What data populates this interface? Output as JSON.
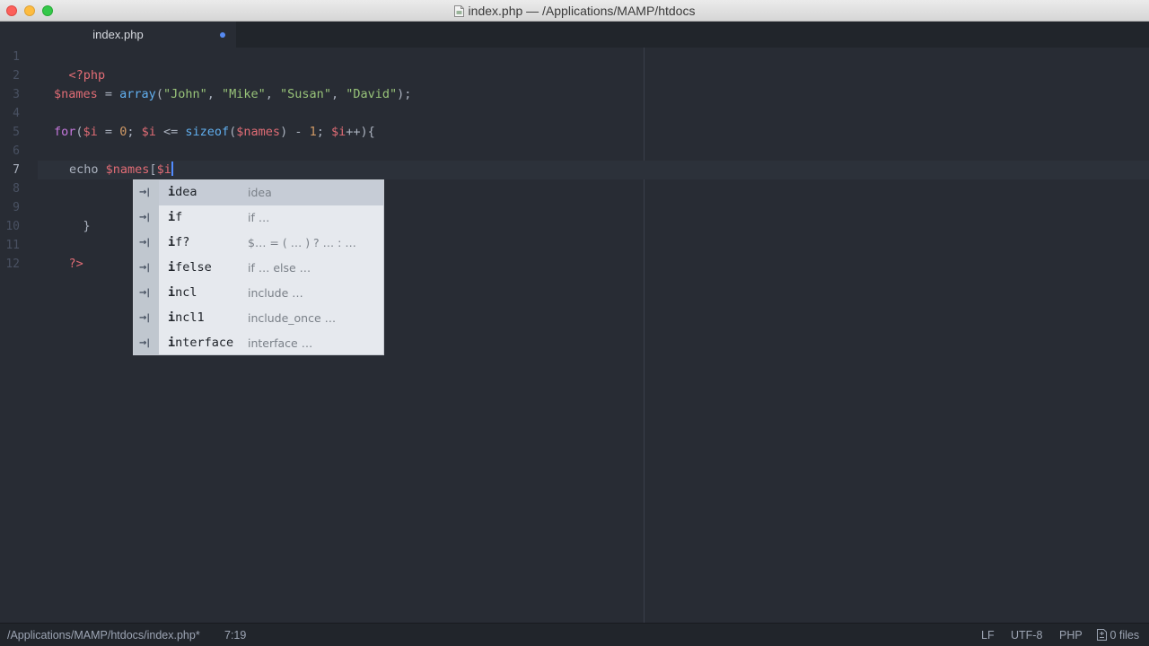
{
  "window": {
    "title": "index.php — /Applications/MAMP/htdocs"
  },
  "tabs": [
    {
      "label": "index.php",
      "modified": true
    }
  ],
  "editor": {
    "line_numbers": [
      "1",
      "2",
      "3",
      "4",
      "5",
      "6",
      "7",
      "8",
      "9",
      "10",
      "11",
      "12"
    ],
    "code": {
      "l1_open": "<?php",
      "l3_var": "$names",
      "l3_eq": " = ",
      "l3_fn": "array",
      "l3_p1": "(",
      "l3_s1": "\"John\"",
      "l3_c1": ", ",
      "l3_s2": "\"Mike\"",
      "l3_c2": ", ",
      "l3_s3": "\"Susan\"",
      "l3_c3": ", ",
      "l3_s4": "\"David\"",
      "l3_end": ");",
      "l5_for": "for",
      "l5_p": "(",
      "l5_v1": "$i",
      "l5_eq": " = ",
      "l5_n0": "0",
      "l5_sc1": "; ",
      "l5_v2": "$i",
      "l5_le": " <= ",
      "l5_fn": "sizeof",
      "l5_p2": "(",
      "l5_v3": "$names",
      "l5_minus": ") - ",
      "l5_n1": "1",
      "l5_sc2": "; ",
      "l5_v4": "$i",
      "l5_end": "++){",
      "l7_echo": "echo ",
      "l7_var": "$names",
      "l7_br": "[",
      "l7_i": "$i",
      "l9_close": "}",
      "l11_close": "?>"
    }
  },
  "autocomplete": {
    "icon": "tab-arrow-icon",
    "icon_glyph": "→|",
    "items": [
      {
        "prefix": "i",
        "rest": "dea",
        "right": "idea"
      },
      {
        "prefix": "i",
        "rest": "f",
        "right": "if …"
      },
      {
        "prefix": "i",
        "rest": "f?",
        "right": "$… = ( … ) ? … : …"
      },
      {
        "prefix": "i",
        "rest": "felse",
        "right": "if … else …"
      },
      {
        "prefix": "i",
        "rest": "ncl",
        "right": "include …"
      },
      {
        "prefix": "i",
        "rest": "ncl1",
        "right": "include_once …"
      },
      {
        "prefix": "i",
        "rest": "nterface",
        "right": "interface …"
      }
    ]
  },
  "status_bar": {
    "file_path": "/Applications/MAMP/htdocs/index.php*",
    "cursor_position": "7:19",
    "line_ending": "LF",
    "encoding": "UTF-8",
    "grammar": "PHP",
    "git_files": "0 files"
  },
  "colors": {
    "editor_bg": "#282c34",
    "accent": "#528bff"
  }
}
